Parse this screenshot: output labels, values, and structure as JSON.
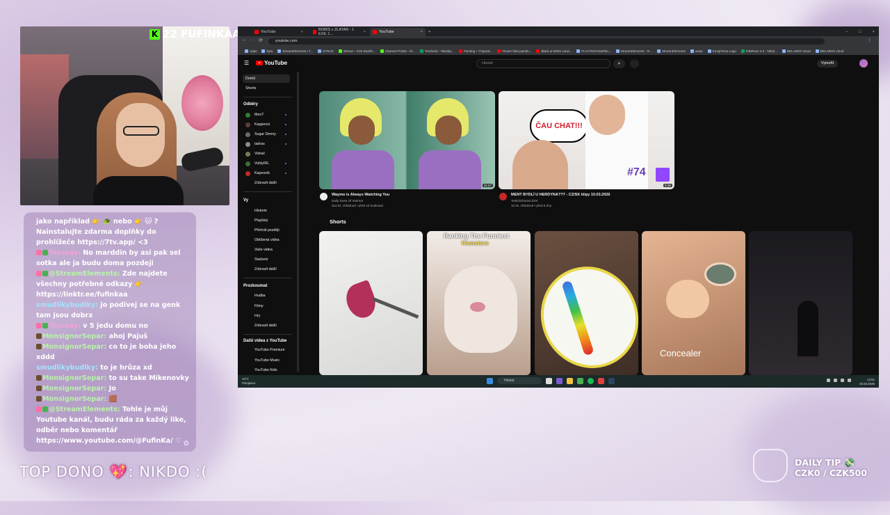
{
  "overlay": {
    "kick_count": "22 FUFINKAA",
    "top_dono": "TOP DONO 💖: NIKDO :(",
    "daily_tip_title": "DAILY TIP 💸",
    "daily_tip_value": "CZK0 / CZK500"
  },
  "chat": {
    "messages": [
      {
        "user": "",
        "text": "jako například 👉 🐢 nebo 👉 🐱 ? Nainstalujte zdarma doplňky do prohlížeče https://7tv.app/ <3"
      },
      {
        "user": "Tessaay:",
        "text": " No marddin by asi pak sel sotka ale ja budu doma pozdeji"
      },
      {
        "user": "@StreamElements:",
        "text": " Zde najdete všechny potřebné odkazy 👉 https://linktr.ee/fufinkaa"
      },
      {
        "user": "smudlikybudlky:",
        "text": " jo podivej se na genk tam jsou dobrx"
      },
      {
        "user": "Tessaay:",
        "text": " v 5 jedu domu no"
      },
      {
        "user": "MonsignorSepar:",
        "text": " ahoj Pajuš"
      },
      {
        "user": "MonsignorSepar:",
        "text": " co to je boha jeho xddd"
      },
      {
        "user": "smudlikybudlky:",
        "text": " to je hrůza xd"
      },
      {
        "user": "MonsignorSepar:",
        "text": " to su take Mikenovky"
      },
      {
        "user": "MonsignorSepar:",
        "text": " Jo"
      },
      {
        "user": "MonsignorSepar:",
        "text": " 🟫"
      },
      {
        "user": "@StreamElements:",
        "text": " Tohle je můj Youtube kanál, budu ráda za každý like, odběr nebo komentář https://www.youtube.com/@FufinKa/ ♡"
      }
    ]
  },
  "browser": {
    "tabs": [
      "YouTube",
      "BORIS v ZLATAN - 1 EXIL 1...",
      "YouTube"
    ],
    "url": "youtube.com",
    "bookmarks": [
      "Apps",
      "byta",
      "StreamElements | T...",
      "SYNCE",
      "Stream - Kick Dashb...",
      "Channel Points - Kl...",
      "Tomfoola - Tabulky...",
      "Painting + Tropical...",
      "Flower field paintin...",
      "Black & White Land...",
      "FLYATION Dashbo...",
      "StreamElements - R...",
      "StreamElements",
      "wasp",
      "EmojiTema Logo",
      "fufaRoon 2.0 - Tabul...",
      "BELABOX cloud",
      "BELABOX cloud"
    ]
  },
  "youtube": {
    "search_placeholder": "Hledat",
    "create_label": "Vytvořit",
    "sidebar": {
      "home": "Domů",
      "shorts": "Shorts",
      "subs_header": "Odběry",
      "subs": [
        "MenT",
        "Kappenzi",
        "Sugar Denny",
        "tadras",
        "Vidrail",
        "VoldyIRL",
        "Kapesník"
      ],
      "show_more": "Zobrazit další",
      "you_header": "Vy",
      "you_items": [
        "Historie",
        "Playlisty",
        "Přehrát později",
        "Oblíbená videa",
        "Vaše videa",
        "Stažené",
        "Zobrazit další"
      ],
      "explore_header": "Prozkoumat",
      "explore_items": [
        "Hudba",
        "Filmy",
        "Hry",
        "Zobrazit další"
      ],
      "more_header": "Další videa z YouTube",
      "more_items": [
        "YouTube Premium",
        "YouTube Music",
        "YouTube Kids"
      ]
    },
    "videos": [
      {
        "title": "Waymo is Always Watching You",
        "channel": "Daily Dose Of Internet",
        "meta": "622 tis. zhlédnutí • před 18 hodinami",
        "duration": "15:07"
      },
      {
        "title": "MENT BYDLÍ U HERDYNA??? - CZ/SK klipy 10.03.2026",
        "channel": "TwitchShortsCZSK",
        "meta": "10 tis. zhlédnutí • před 8 dny",
        "duration": "9:39",
        "thumb_text": "ČAU CHAT!!!",
        "thumb_num": "#74"
      }
    ],
    "shorts_label": "Shorts",
    "shorts": [
      {
        "text": ""
      },
      {
        "text_top": "Ranking The Funniest",
        "text_bottom": "Hamsters"
      },
      {
        "text": ""
      },
      {
        "text": "Concealer"
      },
      {
        "text": ""
      }
    ]
  },
  "taskbar": {
    "weather": "10°C",
    "weather_desc": "Polojasno",
    "search": "Hledat",
    "time": "12:51",
    "date": "20.03.2026"
  }
}
